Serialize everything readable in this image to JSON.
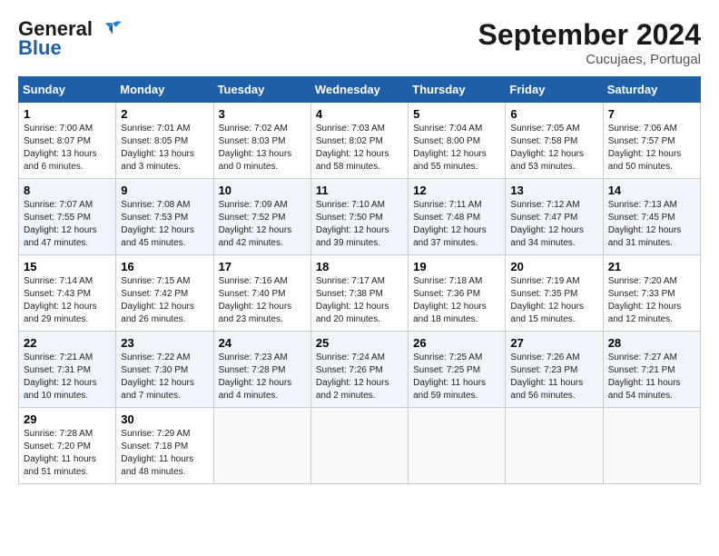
{
  "header": {
    "logo_line1": "General",
    "logo_line2": "Blue",
    "month_title": "September 2024",
    "subtitle": "Cucujaes, Portugal"
  },
  "weekdays": [
    "Sunday",
    "Monday",
    "Tuesday",
    "Wednesday",
    "Thursday",
    "Friday",
    "Saturday"
  ],
  "weeks": [
    [
      {
        "day": "1",
        "sunrise": "7:00 AM",
        "sunset": "8:07 PM",
        "daylight": "13 hours and 6 minutes."
      },
      {
        "day": "2",
        "sunrise": "7:01 AM",
        "sunset": "8:05 PM",
        "daylight": "13 hours and 3 minutes."
      },
      {
        "day": "3",
        "sunrise": "7:02 AM",
        "sunset": "8:03 PM",
        "daylight": "13 hours and 0 minutes."
      },
      {
        "day": "4",
        "sunrise": "7:03 AM",
        "sunset": "8:02 PM",
        "daylight": "12 hours and 58 minutes."
      },
      {
        "day": "5",
        "sunrise": "7:04 AM",
        "sunset": "8:00 PM",
        "daylight": "12 hours and 55 minutes."
      },
      {
        "day": "6",
        "sunrise": "7:05 AM",
        "sunset": "7:58 PM",
        "daylight": "12 hours and 53 minutes."
      },
      {
        "day": "7",
        "sunrise": "7:06 AM",
        "sunset": "7:57 PM",
        "daylight": "12 hours and 50 minutes."
      }
    ],
    [
      {
        "day": "8",
        "sunrise": "7:07 AM",
        "sunset": "7:55 PM",
        "daylight": "12 hours and 47 minutes."
      },
      {
        "day": "9",
        "sunrise": "7:08 AM",
        "sunset": "7:53 PM",
        "daylight": "12 hours and 45 minutes."
      },
      {
        "day": "10",
        "sunrise": "7:09 AM",
        "sunset": "7:52 PM",
        "daylight": "12 hours and 42 minutes."
      },
      {
        "day": "11",
        "sunrise": "7:10 AM",
        "sunset": "7:50 PM",
        "daylight": "12 hours and 39 minutes."
      },
      {
        "day": "12",
        "sunrise": "7:11 AM",
        "sunset": "7:48 PM",
        "daylight": "12 hours and 37 minutes."
      },
      {
        "day": "13",
        "sunrise": "7:12 AM",
        "sunset": "7:47 PM",
        "daylight": "12 hours and 34 minutes."
      },
      {
        "day": "14",
        "sunrise": "7:13 AM",
        "sunset": "7:45 PM",
        "daylight": "12 hours and 31 minutes."
      }
    ],
    [
      {
        "day": "15",
        "sunrise": "7:14 AM",
        "sunset": "7:43 PM",
        "daylight": "12 hours and 29 minutes."
      },
      {
        "day": "16",
        "sunrise": "7:15 AM",
        "sunset": "7:42 PM",
        "daylight": "12 hours and 26 minutes."
      },
      {
        "day": "17",
        "sunrise": "7:16 AM",
        "sunset": "7:40 PM",
        "daylight": "12 hours and 23 minutes."
      },
      {
        "day": "18",
        "sunrise": "7:17 AM",
        "sunset": "7:38 PM",
        "daylight": "12 hours and 20 minutes."
      },
      {
        "day": "19",
        "sunrise": "7:18 AM",
        "sunset": "7:36 PM",
        "daylight": "12 hours and 18 minutes."
      },
      {
        "day": "20",
        "sunrise": "7:19 AM",
        "sunset": "7:35 PM",
        "daylight": "12 hours and 15 minutes."
      },
      {
        "day": "21",
        "sunrise": "7:20 AM",
        "sunset": "7:33 PM",
        "daylight": "12 hours and 12 minutes."
      }
    ],
    [
      {
        "day": "22",
        "sunrise": "7:21 AM",
        "sunset": "7:31 PM",
        "daylight": "12 hours and 10 minutes."
      },
      {
        "day": "23",
        "sunrise": "7:22 AM",
        "sunset": "7:30 PM",
        "daylight": "12 hours and 7 minutes."
      },
      {
        "day": "24",
        "sunrise": "7:23 AM",
        "sunset": "7:28 PM",
        "daylight": "12 hours and 4 minutes."
      },
      {
        "day": "25",
        "sunrise": "7:24 AM",
        "sunset": "7:26 PM",
        "daylight": "12 hours and 2 minutes."
      },
      {
        "day": "26",
        "sunrise": "7:25 AM",
        "sunset": "7:25 PM",
        "daylight": "11 hours and 59 minutes."
      },
      {
        "day": "27",
        "sunrise": "7:26 AM",
        "sunset": "7:23 PM",
        "daylight": "11 hours and 56 minutes."
      },
      {
        "day": "28",
        "sunrise": "7:27 AM",
        "sunset": "7:21 PM",
        "daylight": "11 hours and 54 minutes."
      }
    ],
    [
      {
        "day": "29",
        "sunrise": "7:28 AM",
        "sunset": "7:20 PM",
        "daylight": "11 hours and 51 minutes."
      },
      {
        "day": "30",
        "sunrise": "7:29 AM",
        "sunset": "7:18 PM",
        "daylight": "11 hours and 48 minutes."
      },
      null,
      null,
      null,
      null,
      null
    ]
  ]
}
